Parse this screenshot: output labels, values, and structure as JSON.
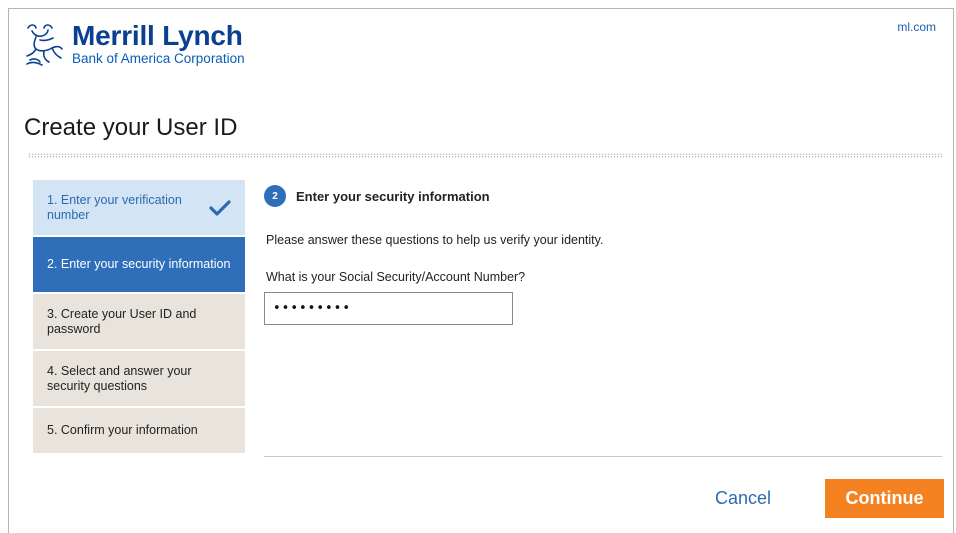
{
  "header": {
    "brand_name": "Merrill Lynch",
    "brand_sub": "Bank of America Corporation",
    "site_link": "ml.com"
  },
  "page": {
    "title": "Create your User ID"
  },
  "steps": [
    {
      "label": "1. Enter your verification number",
      "state": "completed"
    },
    {
      "label": "2. Enter your security information",
      "state": "active"
    },
    {
      "label": "3. Create your User ID and password",
      "state": "pending"
    },
    {
      "label": "4. Select and answer your security questions",
      "state": "pending"
    },
    {
      "label": "5. Confirm your information",
      "state": "pending"
    }
  ],
  "section": {
    "number": "2",
    "title": "Enter your security information",
    "intro": "Please answer these questions to help us verify your identity.",
    "question_label": "What is your Social Security/Account Number?",
    "ssn_value": "•••••••••"
  },
  "actions": {
    "cancel_label": "Cancel",
    "continue_label": "Continue"
  },
  "colors": {
    "brand_blue": "#0b3f8f",
    "step_active": "#2f6fba",
    "step_done": "#d3e4f5",
    "step_pending": "#e8e4dc",
    "continue_orange": "#f58220"
  },
  "icons": {
    "logo": "bull-logo-icon",
    "completed_step": "checkmark-icon"
  }
}
